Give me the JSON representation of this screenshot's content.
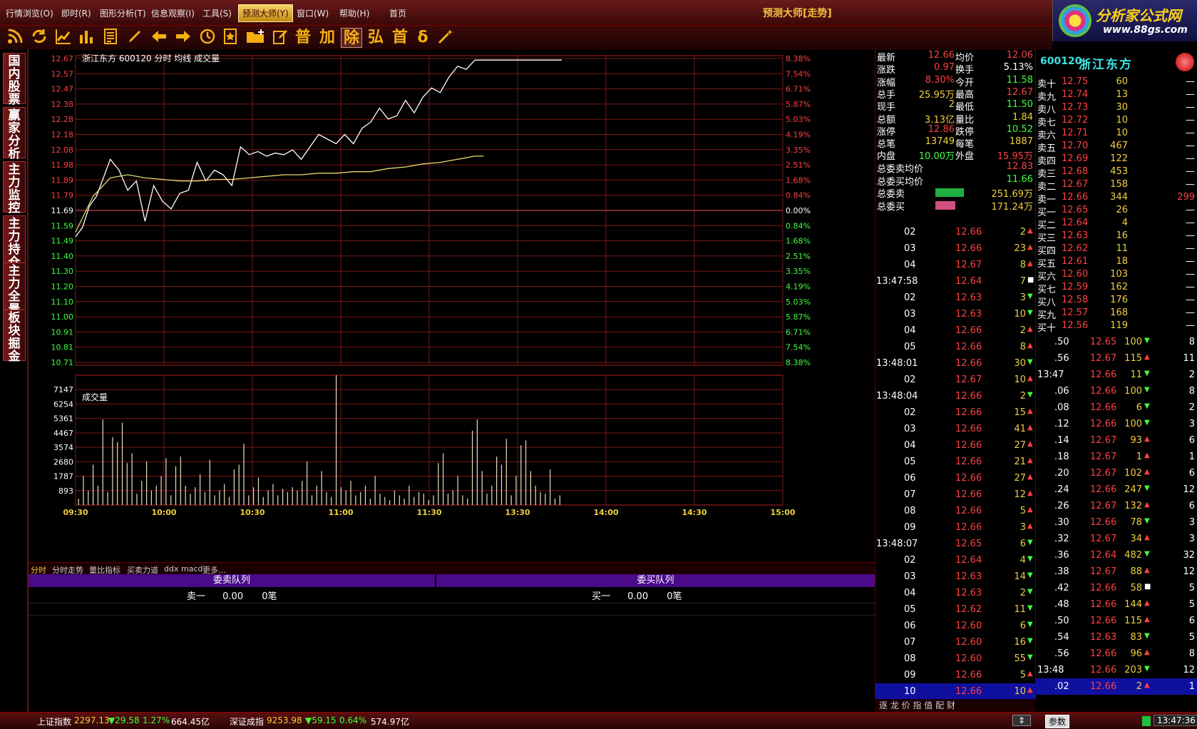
{
  "menu": {
    "items": [
      "行情浏览(O)",
      "即时(R)",
      "图形分析(T)",
      "信息观察(I)",
      "工具(S)",
      "预测大师(Y)",
      "窗口(W)",
      "帮助(H)",
      "首页"
    ],
    "window_title": "预测大师[走势]"
  },
  "logo": {
    "line1": "分析家公式网",
    "line2": "www.88gs.com"
  },
  "toolbar": {
    "glyphs": [
      "普",
      "加",
      "除",
      "弘",
      "首",
      "δ"
    ]
  },
  "leftnav": [
    "国内股票",
    "赢家分析",
    "主力监控",
    "主力持仓",
    "主力全景",
    "板块掘金"
  ],
  "chart_data": {
    "type": "line",
    "title": "浙江东方 600120 分时 均线 成交量",
    "price_ticks": [
      "12.67",
      "12.57",
      "12.47",
      "12.38",
      "12.28",
      "12.18",
      "12.08",
      "11.98",
      "11.89",
      "11.79",
      "11.69",
      "11.59",
      "11.49",
      "11.40",
      "11.30",
      "11.20",
      "11.10",
      "11.00",
      "10.91",
      "10.81",
      "10.71"
    ],
    "pct_ticks": [
      "8.38%",
      "7.54%",
      "6.71%",
      "5.87%",
      "5.03%",
      "4.19%",
      "3.35%",
      "2.51%",
      "1.68%",
      "0.84%",
      "0.00%",
      "0.84%",
      "1.68%",
      "2.51%",
      "3.35%",
      "4.19%",
      "5.03%",
      "5.87%",
      "6.71%",
      "7.54%",
      "8.38%"
    ],
    "ylim": [
      10.71,
      12.67
    ],
    "prev_close": 11.69,
    "time_labels": [
      "09:30",
      "10:00",
      "10:30",
      "11:00",
      "11:30",
      "13:30",
      "14:00",
      "14:30",
      "15:00"
    ],
    "volume_title": "成交量",
    "volume_ticks": [
      "7147",
      "6254",
      "5361",
      "4467",
      "3574",
      "2680",
      "1787",
      "893"
    ],
    "volume_max": 8040,
    "series": [
      {
        "name": "分时",
        "color": "#ffffff",
        "x": [
          0,
          4,
          8,
          12,
          16,
          20,
          25,
          30,
          35,
          40,
          45,
          50,
          55,
          60,
          65,
          70,
          75,
          80,
          85,
          90,
          95,
          100,
          105,
          110,
          115,
          120,
          125,
          130,
          135,
          140,
          145,
          150,
          155,
          160,
          165,
          170,
          175,
          180,
          185,
          190,
          195,
          200,
          205,
          210,
          215,
          220,
          225,
          230,
          235,
          240,
          245,
          250,
          255,
          260,
          265,
          270,
          275,
          280
        ],
        "y": [
          11.52,
          11.58,
          11.72,
          11.78,
          11.9,
          12.02,
          11.95,
          11.82,
          11.88,
          11.62,
          11.85,
          11.75,
          11.7,
          11.8,
          11.82,
          12.0,
          11.88,
          11.95,
          11.92,
          11.85,
          12.1,
          12.05,
          12.07,
          12.04,
          12.06,
          12.05,
          12.08,
          12.02,
          12.1,
          12.18,
          12.15,
          12.12,
          12.18,
          12.12,
          12.22,
          12.26,
          12.35,
          12.28,
          12.3,
          12.4,
          12.32,
          12.42,
          12.48,
          12.45,
          12.55,
          12.62,
          12.6,
          12.66,
          12.66,
          12.66,
          12.66,
          12.66,
          12.66,
          12.66,
          12.66,
          12.66,
          12.66,
          12.66
        ]
      },
      {
        "name": "均线",
        "color": "#e8d870",
        "x": [
          0,
          10,
          20,
          30,
          40,
          50,
          60,
          70,
          80,
          90,
          100,
          110,
          120,
          130,
          140,
          150,
          160,
          170,
          180,
          190,
          200,
          210,
          220,
          230,
          235
        ],
        "y": [
          11.55,
          11.78,
          11.9,
          11.92,
          11.9,
          11.89,
          11.88,
          11.88,
          11.89,
          11.89,
          11.9,
          11.91,
          11.92,
          11.92,
          11.93,
          11.93,
          11.94,
          11.94,
          11.96,
          11.97,
          11.99,
          12.0,
          12.02,
          12.04,
          12.04
        ]
      }
    ],
    "volume": [
      400,
      1800,
      900,
      2500,
      1200,
      5300,
      800,
      4200,
      3900,
      5100,
      2600,
      3200,
      700,
      1500,
      2700,
      900,
      1200,
      1800,
      2900,
      600,
      2400,
      3000,
      1200,
      700,
      1100,
      1900,
      800,
      2800,
      600,
      900,
      1300,
      500,
      2200,
      2500,
      3800,
      600,
      1100,
      1700,
      500,
      900,
      1300,
      600,
      1000,
      800,
      1100,
      900,
      1500,
      2700,
      600,
      1200,
      2100,
      800,
      500,
      9000,
      1100,
      900,
      1500,
      600,
      800,
      1200,
      400,
      1800,
      700,
      500,
      300,
      900,
      600,
      400,
      1200,
      500,
      800,
      700,
      300,
      600,
      2600,
      3200,
      700,
      900,
      1800,
      600,
      400,
      4600,
      5300,
      2100,
      700,
      1200,
      3000,
      2500,
      4100,
      600,
      1800,
      3700,
      4000,
      2100,
      1200,
      800,
      700,
      2200,
      400,
      600
    ]
  },
  "bottom_tabs": [
    "分时",
    "分时走势",
    "量比指标",
    "买卖力道",
    "ddx",
    "macd",
    "更多..."
  ],
  "queues": {
    "sell_title": "委卖队列",
    "buy_title": "委买队列",
    "sell_row": {
      "label": "卖一",
      "price": "0.00",
      "count": "0笔"
    },
    "buy_row": {
      "label": "买一",
      "price": "0.00",
      "count": "0笔"
    }
  },
  "quote": [
    {
      "l": "最新",
      "v": "12.66",
      "vc": "red",
      "l2": "均价",
      "v2": "12.06",
      "v2c": "red"
    },
    {
      "l": "涨跌",
      "v": "0.97",
      "vc": "red",
      "l2": "换手",
      "v2": "5.13%",
      "v2c": "white"
    },
    {
      "l": "涨幅",
      "v": "8.30%",
      "vc": "red",
      "l2": "今开",
      "v2": "11.58",
      "v2c": "green"
    },
    {
      "l": "总手",
      "v": "25.95万",
      "vc": "yellow",
      "l2": "最高",
      "v2": "12.67",
      "v2c": "red"
    },
    {
      "l": "现手",
      "v": "2",
      "vc": "yellow",
      "l2": "最低",
      "v2": "11.50",
      "v2c": "green"
    },
    {
      "l": "总额",
      "v": "3.13亿",
      "vc": "yellow",
      "l2": "量比",
      "v2": "1.84",
      "v2c": "yellow"
    },
    {
      "l": "涨停",
      "v": "12.86",
      "vc": "red",
      "l2": "跌停",
      "v2": "10.52",
      "v2c": "green"
    },
    {
      "l": "总笔",
      "v": "13749",
      "vc": "yellow",
      "l2": "每笔",
      "v2": "1887",
      "v2c": "yellow"
    },
    {
      "l": "内盘",
      "v": "10.00万",
      "vc": "green",
      "l2": "外盘",
      "v2": "15.95万",
      "v2c": "red"
    }
  ],
  "quote_extra": [
    {
      "l": "总委卖均价",
      "v": "12.83",
      "vc": "red"
    },
    {
      "l": "总委买均价",
      "v": "11.66",
      "vc": "green"
    },
    {
      "l": "总委卖",
      "v": "251.69万",
      "vc": "yellow",
      "bar": "#20b040",
      "bar_fill": 0.67
    },
    {
      "l": "总委买",
      "v": "171.24万",
      "vc": "yellow",
      "bar": "#d05080",
      "bar_fill": 0.47
    }
  ],
  "ticks": [
    {
      "t": "02",
      "p": "12.66",
      "v": "2",
      "d": "up"
    },
    {
      "t": "03",
      "p": "12.66",
      "v": "23",
      "d": "up"
    },
    {
      "t": "04",
      "p": "12.67",
      "v": "8",
      "d": "up"
    },
    {
      "t": "13:47:58",
      "p": "12.64",
      "v": "7",
      "d": "eq"
    },
    {
      "t": "02",
      "p": "12.63",
      "v": "3",
      "d": "down"
    },
    {
      "t": "03",
      "p": "12.63",
      "v": "10",
      "d": "down"
    },
    {
      "t": "04",
      "p": "12.66",
      "v": "2",
      "d": "up"
    },
    {
      "t": "05",
      "p": "12.66",
      "v": "8",
      "d": "up"
    },
    {
      "t": "13:48:01",
      "p": "12.66",
      "v": "30",
      "d": "down"
    },
    {
      "t": "02",
      "p": "12.67",
      "v": "10",
      "d": "up"
    },
    {
      "t": "13:48:04",
      "p": "12.66",
      "v": "2",
      "d": "down"
    },
    {
      "t": "02",
      "p": "12.66",
      "v": "15",
      "d": "up"
    },
    {
      "t": "03",
      "p": "12.66",
      "v": "41",
      "d": "up"
    },
    {
      "t": "04",
      "p": "12.66",
      "v": "27",
      "d": "up"
    },
    {
      "t": "05",
      "p": "12.66",
      "v": "21",
      "d": "up"
    },
    {
      "t": "06",
      "p": "12.66",
      "v": "27",
      "d": "up"
    },
    {
      "t": "07",
      "p": "12.66",
      "v": "12",
      "d": "up"
    },
    {
      "t": "08",
      "p": "12.66",
      "v": "5",
      "d": "up"
    },
    {
      "t": "09",
      "p": "12.66",
      "v": "3",
      "d": "up"
    },
    {
      "t": "13:48:07",
      "p": "12.65",
      "v": "6",
      "d": "down"
    },
    {
      "t": "02",
      "p": "12.64",
      "v": "4",
      "d": "down"
    },
    {
      "t": "03",
      "p": "12.63",
      "v": "14",
      "d": "down"
    },
    {
      "t": "04",
      "p": "12.63",
      "v": "2",
      "d": "down"
    },
    {
      "t": "05",
      "p": "12.62",
      "v": "11",
      "d": "down"
    },
    {
      "t": "06",
      "p": "12.60",
      "v": "6",
      "d": "down"
    },
    {
      "t": "07",
      "p": "12.60",
      "v": "16",
      "d": "down"
    },
    {
      "t": "08",
      "p": "12.60",
      "v": "55",
      "d": "down"
    },
    {
      "t": "09",
      "p": "12.66",
      "v": "5",
      "d": "up"
    },
    {
      "t": "10",
      "p": "12.66",
      "v": "10",
      "d": "up"
    }
  ],
  "tick_tabs": "逐 龙 价 指 值 配 财",
  "book": {
    "code": "600120",
    "name": "浙江东方",
    "rows": [
      {
        "l": "卖十",
        "p": "12.75",
        "v": "60",
        "x": "—"
      },
      {
        "l": "卖九",
        "p": "12.74",
        "v": "13",
        "x": "—"
      },
      {
        "l": "卖八",
        "p": "12.73",
        "v": "30",
        "x": "—"
      },
      {
        "l": "卖七",
        "p": "12.72",
        "v": "10",
        "x": "—"
      },
      {
        "l": "卖六",
        "p": "12.71",
        "v": "10",
        "x": "—"
      },
      {
        "l": "卖五",
        "p": "12.70",
        "v": "467",
        "x": "—"
      },
      {
        "l": "卖四",
        "p": "12.69",
        "v": "122",
        "x": "—"
      },
      {
        "l": "卖三",
        "p": "12.68",
        "v": "453",
        "x": "—"
      },
      {
        "l": "卖二",
        "p": "12.67",
        "v": "158",
        "x": "—"
      },
      {
        "l": "卖一",
        "p": "12.66",
        "v": "344",
        "x": "299"
      },
      {
        "l": "买一",
        "p": "12.65",
        "v": "26",
        "x": "—"
      },
      {
        "l": "买二",
        "p": "12.64",
        "v": "4",
        "x": "—"
      },
      {
        "l": "买三",
        "p": "12.63",
        "v": "16",
        "x": "—"
      },
      {
        "l": "买四",
        "p": "12.62",
        "v": "11",
        "x": "—"
      },
      {
        "l": "买五",
        "p": "12.61",
        "v": "18",
        "x": "—"
      },
      {
        "l": "买六",
        "p": "12.60",
        "v": "103",
        "x": "—"
      },
      {
        "l": "买七",
        "p": "12.59",
        "v": "162",
        "x": "—"
      },
      {
        "l": "买八",
        "p": "12.58",
        "v": "176",
        "x": "—"
      },
      {
        "l": "买九",
        "p": "12.57",
        "v": "168",
        "x": "—"
      },
      {
        "l": "买十",
        "p": "12.56",
        "v": "119",
        "x": "—"
      }
    ]
  },
  "ticks2": [
    {
      "t": ".50",
      "p": "12.65",
      "v": "100",
      "d": "down",
      "n": "8"
    },
    {
      "t": ".56",
      "p": "12.67",
      "v": "115",
      "d": "up",
      "n": "11"
    },
    {
      "t": "13:47",
      "p": "12.66",
      "v": "11",
      "d": "down",
      "n": "2"
    },
    {
      "t": ".06",
      "p": "12.66",
      "v": "100",
      "d": "down",
      "n": "8"
    },
    {
      "t": ".08",
      "p": "12.66",
      "v": "6",
      "d": "down",
      "n": "2"
    },
    {
      "t": ".12",
      "p": "12.66",
      "v": "100",
      "d": "down",
      "n": "3"
    },
    {
      "t": ".14",
      "p": "12.67",
      "v": "93",
      "d": "up",
      "n": "6"
    },
    {
      "t": ".18",
      "p": "12.67",
      "v": "1",
      "d": "up",
      "n": "1"
    },
    {
      "t": ".20",
      "p": "12.67",
      "v": "102",
      "d": "up",
      "n": "6"
    },
    {
      "t": ".24",
      "p": "12.66",
      "v": "247",
      "d": "down",
      "n": "12"
    },
    {
      "t": ".26",
      "p": "12.67",
      "v": "132",
      "d": "up",
      "n": "6"
    },
    {
      "t": ".30",
      "p": "12.66",
      "v": "78",
      "d": "down",
      "n": "3"
    },
    {
      "t": ".32",
      "p": "12.67",
      "v": "34",
      "d": "up",
      "n": "3"
    },
    {
      "t": ".36",
      "p": "12.64",
      "v": "482",
      "d": "down",
      "n": "32"
    },
    {
      "t": ".38",
      "p": "12.67",
      "v": "88",
      "d": "up",
      "n": "12"
    },
    {
      "t": ".42",
      "p": "12.66",
      "v": "58",
      "d": "eq",
      "n": "5"
    },
    {
      "t": ".48",
      "p": "12.66",
      "v": "144",
      "d": "up",
      "n": "5"
    },
    {
      "t": ".50",
      "p": "12.66",
      "v": "115",
      "d": "up",
      "n": "6"
    },
    {
      "t": ".54",
      "p": "12.63",
      "v": "83",
      "d": "down",
      "n": "5"
    },
    {
      "t": ".56",
      "p": "12.66",
      "v": "96",
      "d": "up",
      "n": "8"
    },
    {
      "t": "13:48",
      "p": "12.66",
      "v": "203",
      "d": "down",
      "n": "12"
    },
    {
      "t": ".02",
      "p": "12.66",
      "v": "2",
      "d": "up",
      "n": "1"
    }
  ],
  "status": {
    "sh_name": "上证指数",
    "sh_val": "2297.13",
    "sh_chg": "▼29.58",
    "sh_pct": "1.27%",
    "sh_amt": "664.45亿",
    "sz_name": "深证成指",
    "sz_val": "9253.98",
    "sz_chg": "▼59.15",
    "sz_pct": "0.64%",
    "sz_amt": "574.97亿",
    "btn": "参数",
    "time": "13:47:36"
  }
}
